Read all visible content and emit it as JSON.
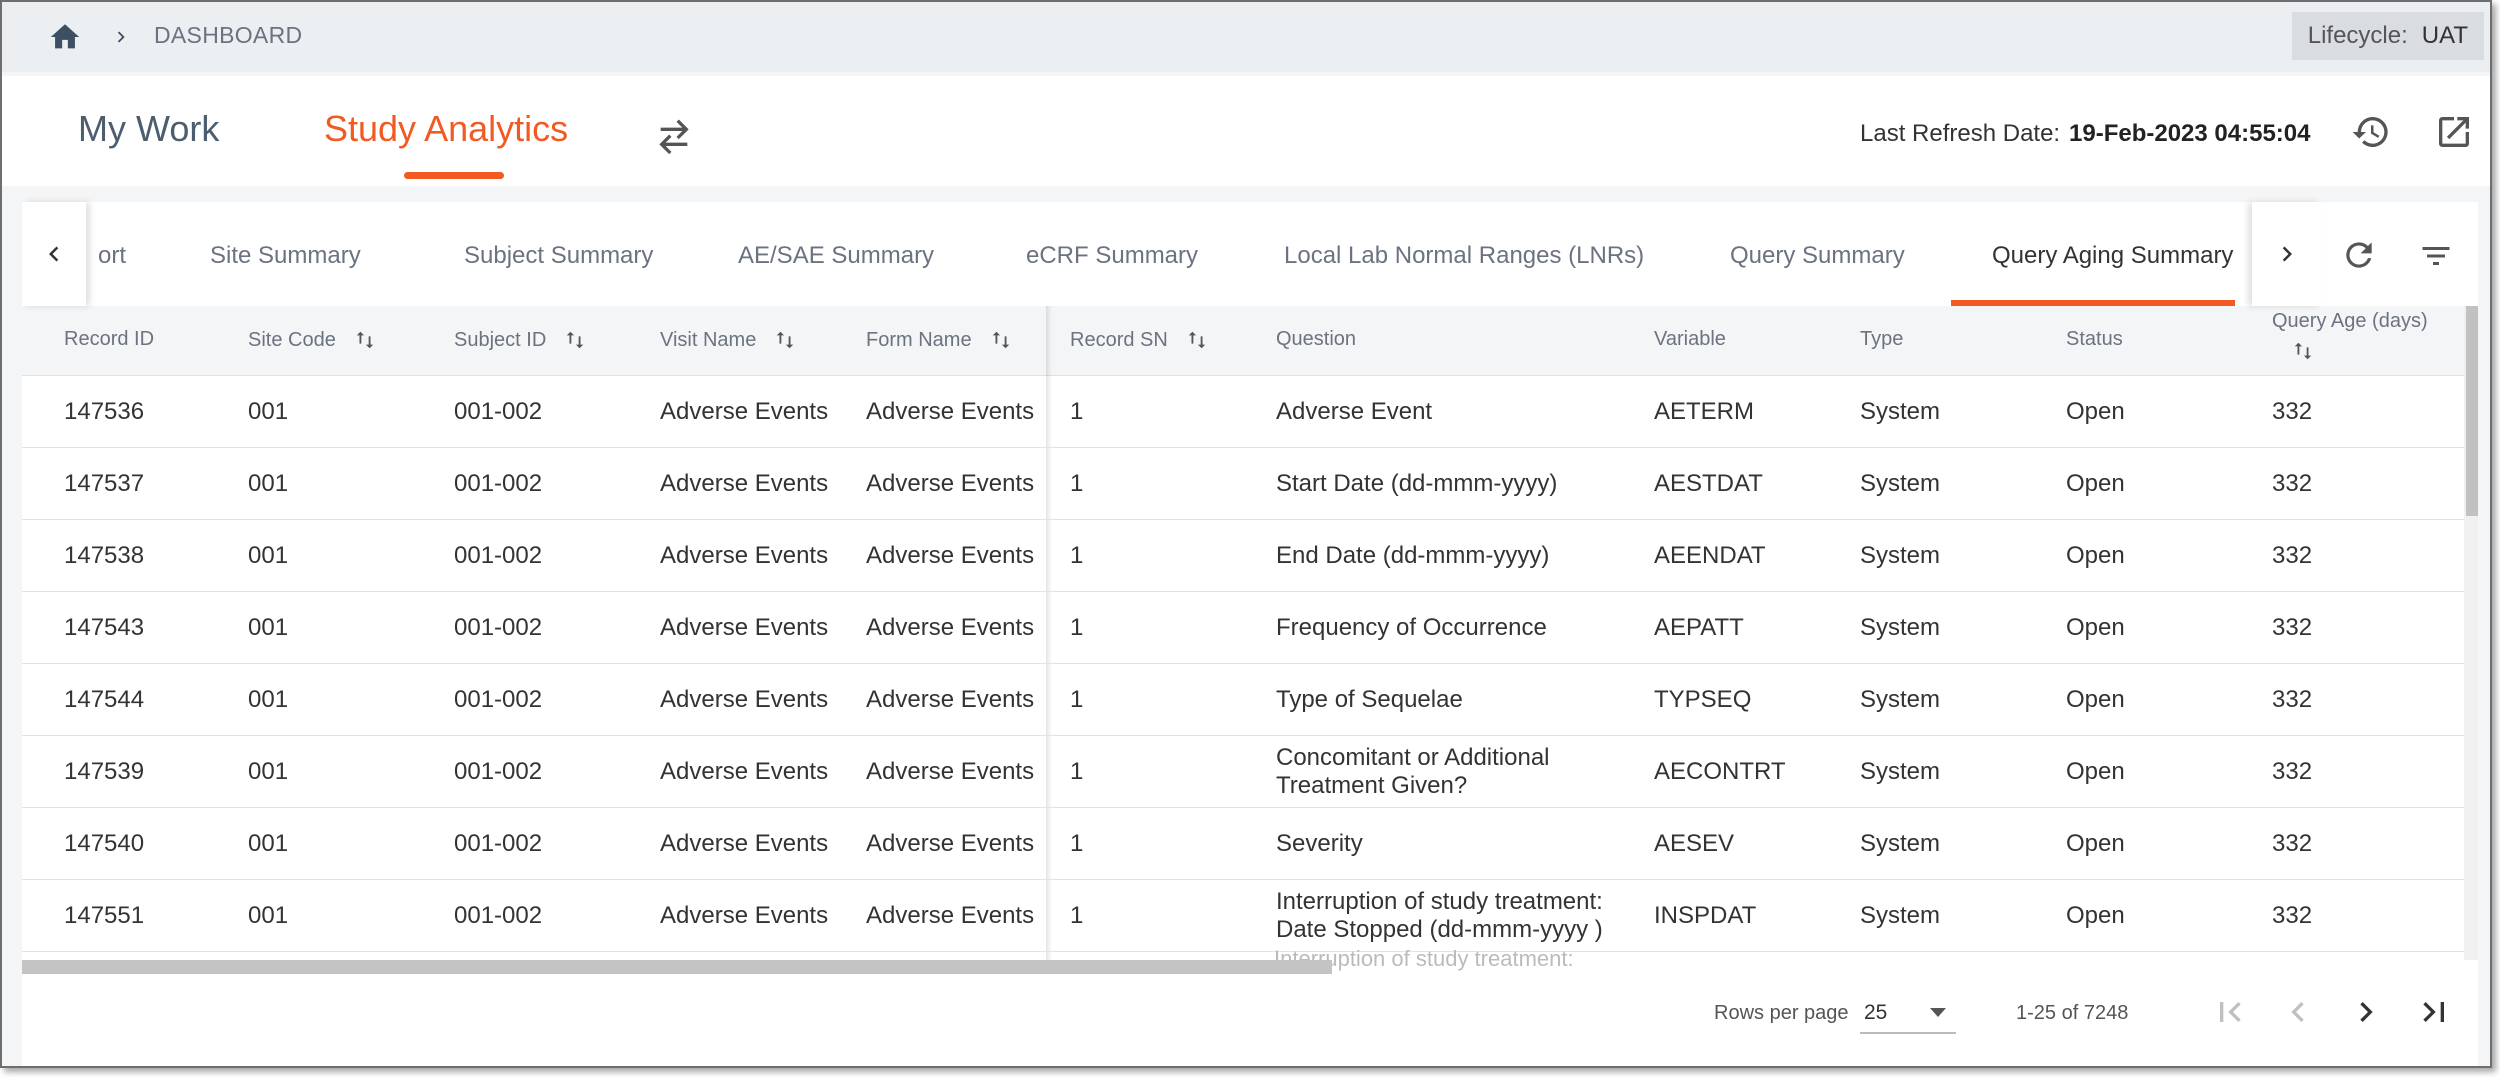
{
  "breadcrumb": {
    "item": "DASHBOARD"
  },
  "lifecycle": {
    "label": "Lifecycle:",
    "value": "UAT"
  },
  "nav": {
    "my_work": "My Work",
    "study_analytics": "Study Analytics"
  },
  "refresh": {
    "label": "Last Refresh Date:",
    "value": "19-Feb-2023 04:55:04"
  },
  "tabs": [
    {
      "label": "ort"
    },
    {
      "label": "Site Summary"
    },
    {
      "label": "Subject Summary"
    },
    {
      "label": "AE/SAE Summary"
    },
    {
      "label": "eCRF Summary"
    },
    {
      "label": "Local Lab Normal Ranges (LNRs)"
    },
    {
      "label": "Query Summary"
    },
    {
      "label": "Query Aging Summary"
    }
  ],
  "table": {
    "columns": [
      "Record ID",
      "Site Code",
      "Subject ID",
      "Visit Name",
      "Form Name",
      "Record SN",
      "Question",
      "Variable",
      "Type",
      "Status",
      "Query Age (days)"
    ],
    "rows": [
      [
        "147536",
        "001",
        "001-002",
        "Adverse Events",
        "Adverse Events",
        "1",
        "Adverse Event",
        "AETERM",
        "System",
        "Open",
        "332"
      ],
      [
        "147537",
        "001",
        "001-002",
        "Adverse Events",
        "Adverse Events",
        "1",
        "Start Date (dd-mmm-yyyy)",
        "AESTDAT",
        "System",
        "Open",
        "332"
      ],
      [
        "147538",
        "001",
        "001-002",
        "Adverse Events",
        "Adverse Events",
        "1",
        "End Date (dd-mmm-yyyy)",
        "AEENDAT",
        "System",
        "Open",
        "332"
      ],
      [
        "147543",
        "001",
        "001-002",
        "Adverse Events",
        "Adverse Events",
        "1",
        "Frequency of Occurrence",
        "AEPATT",
        "System",
        "Open",
        "332"
      ],
      [
        "147544",
        "001",
        "001-002",
        "Adverse Events",
        "Adverse Events",
        "1",
        "Type of Sequelae",
        "TYPSEQ",
        "System",
        "Open",
        "332"
      ],
      [
        "147539",
        "001",
        "001-002",
        "Adverse Events",
        "Adverse Events",
        "1",
        "Concomitant or Additional Treatment Given?",
        "AECONTRT",
        "System",
        "Open",
        "332"
      ],
      [
        "147540",
        "001",
        "001-002",
        "Adverse Events",
        "Adverse Events",
        "1",
        "Severity",
        "AESEV",
        "System",
        "Open",
        "332"
      ],
      [
        "147551",
        "001",
        "001-002",
        "Adverse Events",
        "Adverse Events",
        "1",
        "Interruption of study treatment: Date Stopped (dd-mmm-yyyy )",
        "INSPDAT",
        "System",
        "Open",
        "332"
      ]
    ],
    "partial_row_text": "Interruption of study treatment:"
  },
  "pagination": {
    "rows_per_page_label": "Rows per page",
    "rows_per_page": "25",
    "range": "1-25 of 7248"
  },
  "colors": {
    "accent": "#f15a22",
    "nav_inactive": "#4b5d6e",
    "header_bg": "#eceff1"
  }
}
